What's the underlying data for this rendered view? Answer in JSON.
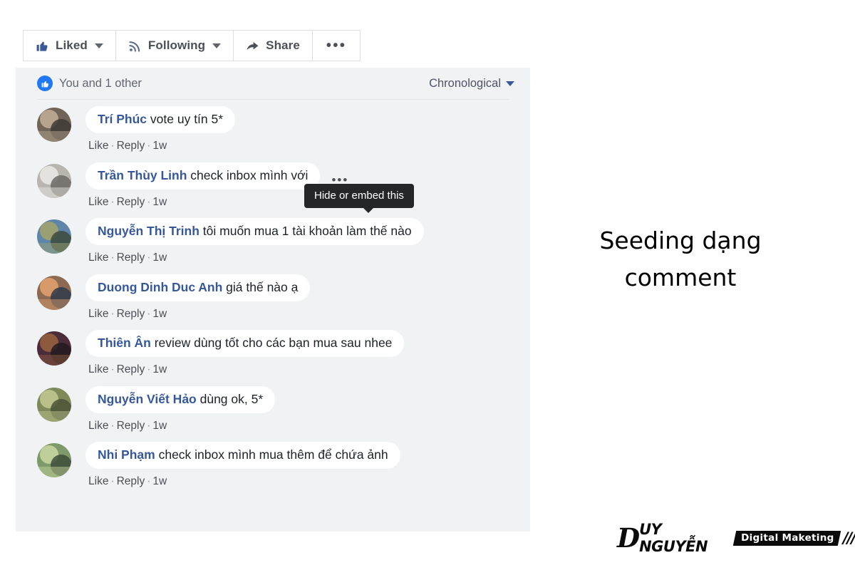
{
  "action_bar": {
    "buttons": [
      {
        "label": "Liked",
        "icon": "thumbs-up-icon",
        "caret": true,
        "name": "liked-button"
      },
      {
        "label": "Following",
        "icon": "rss-icon",
        "caret": true,
        "name": "following-button"
      },
      {
        "label": "Share",
        "icon": "share-arrow-icon",
        "caret": false,
        "name": "share-button"
      },
      {
        "label": "•••",
        "icon": "ellipsis-icon",
        "caret": false,
        "name": "more-options-button"
      }
    ]
  },
  "reactions": {
    "summary_text": "You and 1 other",
    "badge_icon": "like-badge-icon"
  },
  "sort": {
    "label": "Chronological",
    "caret_icon": "chevron-down-icon"
  },
  "tooltip": {
    "text": "Hide or embed this"
  },
  "comments": [
    {
      "author": "Trí Phúc",
      "text": " vote uy tín 5*",
      "like": "Like",
      "reply": "Reply",
      "time": "1w",
      "dots": false,
      "avatar_colors": [
        "#6f6456",
        "#b6a48e",
        "#3e3a35"
      ]
    },
    {
      "author": "Trần Thùy Linh",
      "text": " check inbox mình với",
      "like": "Like",
      "reply": "Reply",
      "time": "1w",
      "dots": true,
      "avatar_colors": [
        "#b9b6b0",
        "#e4e2de",
        "#6d6a66"
      ]
    },
    {
      "author": "Nguyễn Thị Trinh",
      "text": " tôi muốn mua 1 tài khoản làm thế nào",
      "like": "Like",
      "reply": "Reply",
      "time": "1w",
      "dots": false,
      "avatar_colors": [
        "#5f86a8",
        "#9a9f74",
        "#3c4a3a"
      ]
    },
    {
      "author": "Duong Dinh Duc Anh",
      "text": " giá thế nào ạ",
      "like": "Like",
      "reply": "Reply",
      "time": "1w",
      "dots": false,
      "avatar_colors": [
        "#8d6b52",
        "#d89a6a",
        "#2f3a4a"
      ]
    },
    {
      "author": "Thiên Ân",
      "text": " review dùng tốt cho các bạn mua sau nhee",
      "like": "Like",
      "reply": "Reply",
      "time": "1w",
      "dots": false,
      "avatar_colors": [
        "#4b2c3a",
        "#8e5a3d",
        "#241a20"
      ]
    },
    {
      "author": "Nguyễn Viết Hảo",
      "text": " dùng ok, 5*",
      "like": "Like",
      "reply": "Reply",
      "time": "1w",
      "dots": false,
      "avatar_colors": [
        "#7e8a5a",
        "#b9c08a",
        "#4a5236"
      ]
    },
    {
      "author": "Nhi Phạm",
      "text": " check inbox mình mua thêm để chứa ảnh",
      "like": "Like",
      "reply": "Reply",
      "time": "1w",
      "dots": false,
      "avatar_colors": [
        "#7f9a6a",
        "#bfcf9a",
        "#3e4d3a"
      ]
    }
  ],
  "caption": {
    "line1": "Seeding dạng",
    "line2": "comment"
  },
  "logo": {
    "mark": "D",
    "name": "UY NGUYỄN",
    "tagline": "Digital Maketing",
    "slashes": "///"
  },
  "colors": {
    "facebook_blue": "#365899",
    "like_blue": "#2078f4",
    "panel_bg": "#f1f2f4",
    "bubble_bg": "#ffffff",
    "meta_text": "#4b4f56",
    "tooltip_bg": "#252627"
  }
}
